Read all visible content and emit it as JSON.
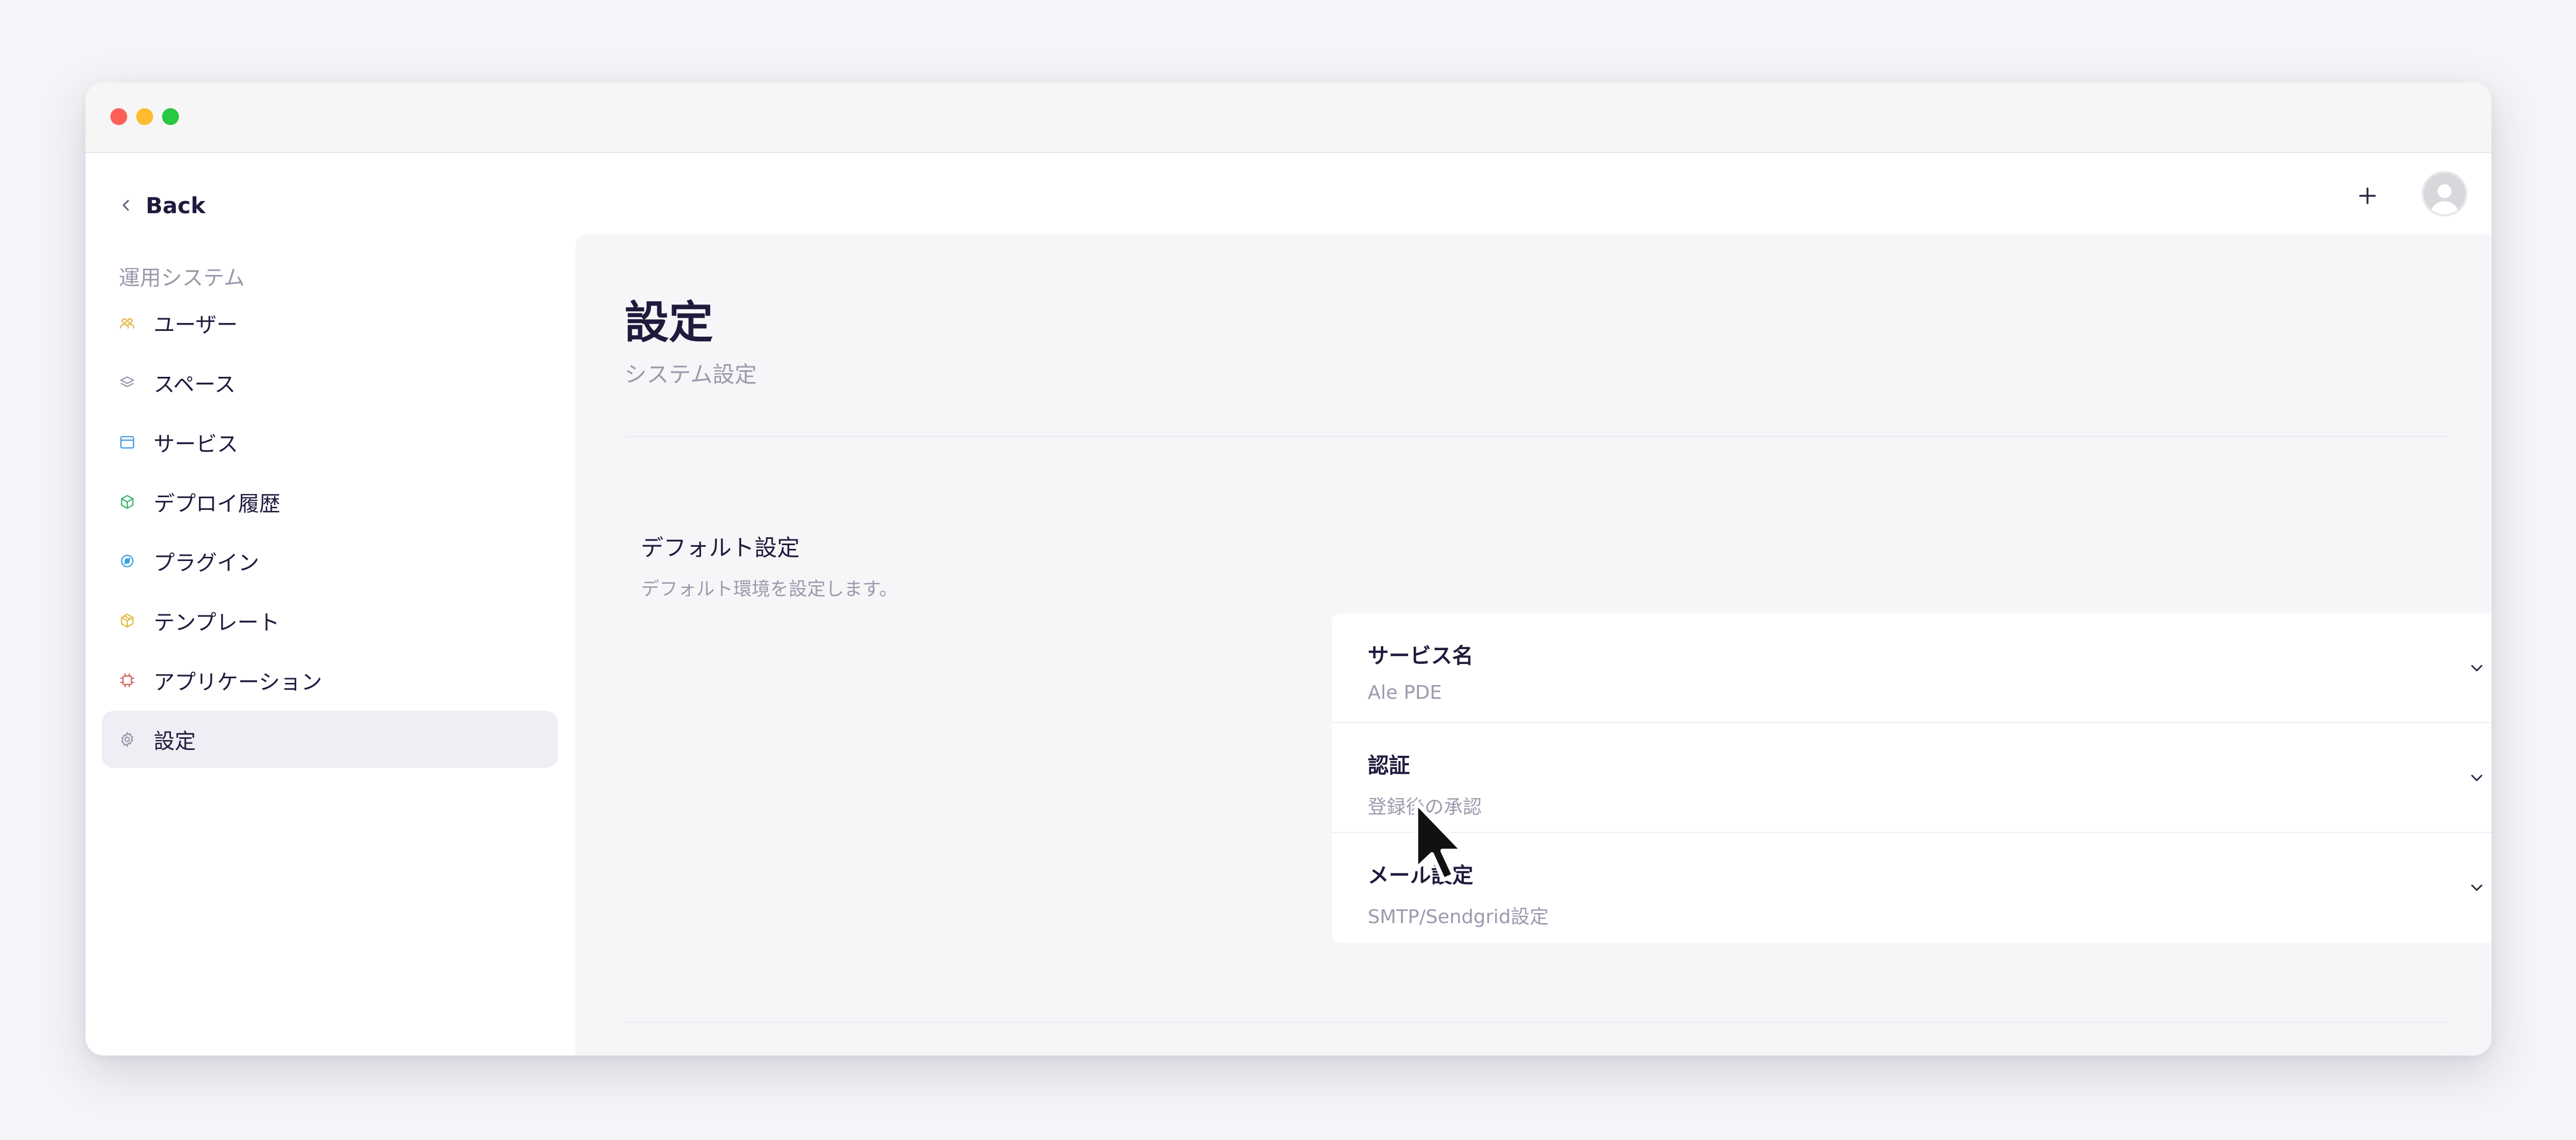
{
  "nav": {
    "back_label": "Back"
  },
  "sidebar": {
    "section_title": "運用システム",
    "items": [
      {
        "label": "ユーザー",
        "icon": "users-icon",
        "color": "#e5b84a"
      },
      {
        "label": "スペース",
        "icon": "layers-icon",
        "color": "#9a98ab"
      },
      {
        "label": "サービス",
        "icon": "window-icon",
        "color": "#4a9de5"
      },
      {
        "label": "デプロイ履歴",
        "icon": "cube-icon",
        "color": "#38b56a"
      },
      {
        "label": "プラグイン",
        "icon": "plugin-icon",
        "color": "#3aa0e0"
      },
      {
        "label": "テンプレート",
        "icon": "package-icon",
        "color": "#e5b84a"
      },
      {
        "label": "アプリケーション",
        "icon": "chip-icon",
        "color": "#d6675b"
      },
      {
        "label": "設定",
        "icon": "gear-icon",
        "color": "#9a98ab",
        "active": true
      }
    ]
  },
  "page": {
    "title": "設定",
    "subtitle": "システム設定"
  },
  "section": {
    "title": "デフォルト設定",
    "description": "デフォルト環境を設定します。"
  },
  "settings": [
    {
      "title": "サービス名",
      "value": "Ale PDE"
    },
    {
      "title": "認証",
      "value": "登録後の承認"
    },
    {
      "title": "メール設定",
      "value": "SMTP/Sendgrid設定"
    }
  ]
}
